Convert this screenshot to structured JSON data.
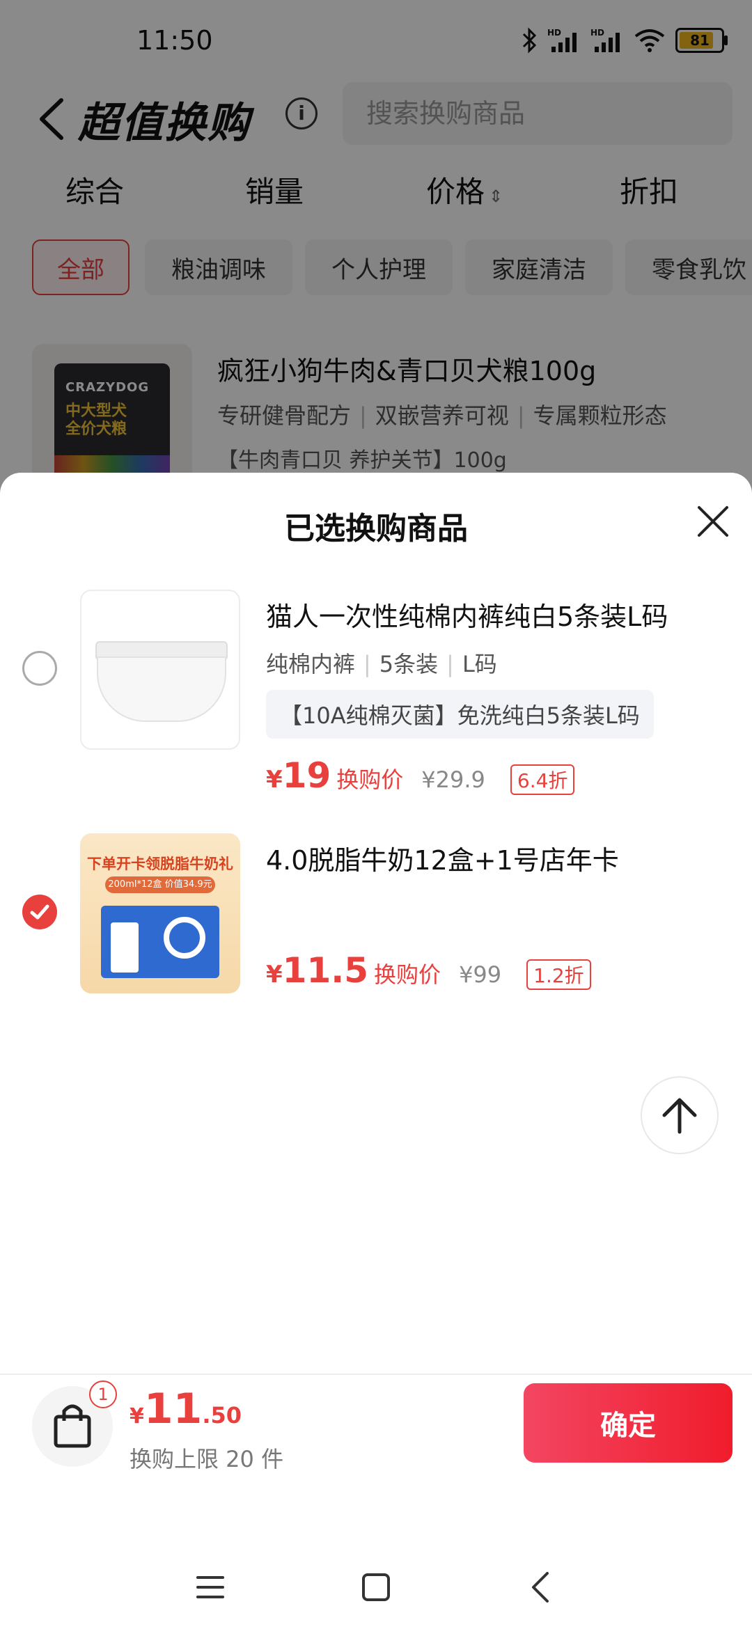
{
  "status_bar": {
    "time": "11:50",
    "battery": "81",
    "signal1_label": "HD",
    "signal2_label": "HD",
    "icons": [
      "bluetooth-icon",
      "signal-icon",
      "signal-icon",
      "wifi-icon",
      "battery-icon"
    ]
  },
  "header": {
    "title": "超值换购",
    "search_placeholder": "搜索换购商品"
  },
  "sort_tabs": [
    "综合",
    "销量",
    "价格",
    "折扣"
  ],
  "categories": {
    "items": [
      "全部",
      "粮油调味",
      "个人护理",
      "家庭清洁",
      "零食乳饮"
    ],
    "selected": "全部"
  },
  "background_product": {
    "name": "疯狂小狗牛肉&青口贝犬粮100g",
    "tags": [
      "专研健骨配方",
      "双嵌营养可视",
      "专属颗粒形态"
    ],
    "promo": "【牛肉青口贝 养护关节】100g",
    "thumb_brand": "CRAZYDOG",
    "thumb_line1": "中大型犬",
    "thumb_line2": "全价犬粮"
  },
  "sheet": {
    "title": "已选换购商品",
    "items": [
      {
        "name": "猫人一次性纯棉内裤纯白5条装L码",
        "specs": [
          "纯棉内裤",
          "5条装",
          "L码"
        ],
        "promo": "【10A纯棉灭菌】免洗纯白5条装L码",
        "currency": "¥",
        "price": "19",
        "price_label": "换购价",
        "original_price": "¥29.9",
        "discount": "6.4折",
        "selected": false
      },
      {
        "name": "4.0脱脂牛奶12盒+1号店年卡",
        "currency": "¥",
        "price": "11.5",
        "price_label": "换购价",
        "original_price": "¥99",
        "discount": "1.2折",
        "selected": true,
        "thumb_headline": "下单开卡领脱脂牛奶礼盒",
        "thumb_subline": "200ml*12盒 价值34.9元"
      }
    ]
  },
  "bottom_bar": {
    "cart_count": "1",
    "currency": "¥",
    "total_int": "11",
    "total_dec": ".50",
    "limit_text": "换购上限 20 件",
    "confirm_label": "确定"
  },
  "colors": {
    "accent": "#e8403d",
    "confirm_gradient_start": "#f34662",
    "confirm_gradient_end": "#f01c2c"
  }
}
